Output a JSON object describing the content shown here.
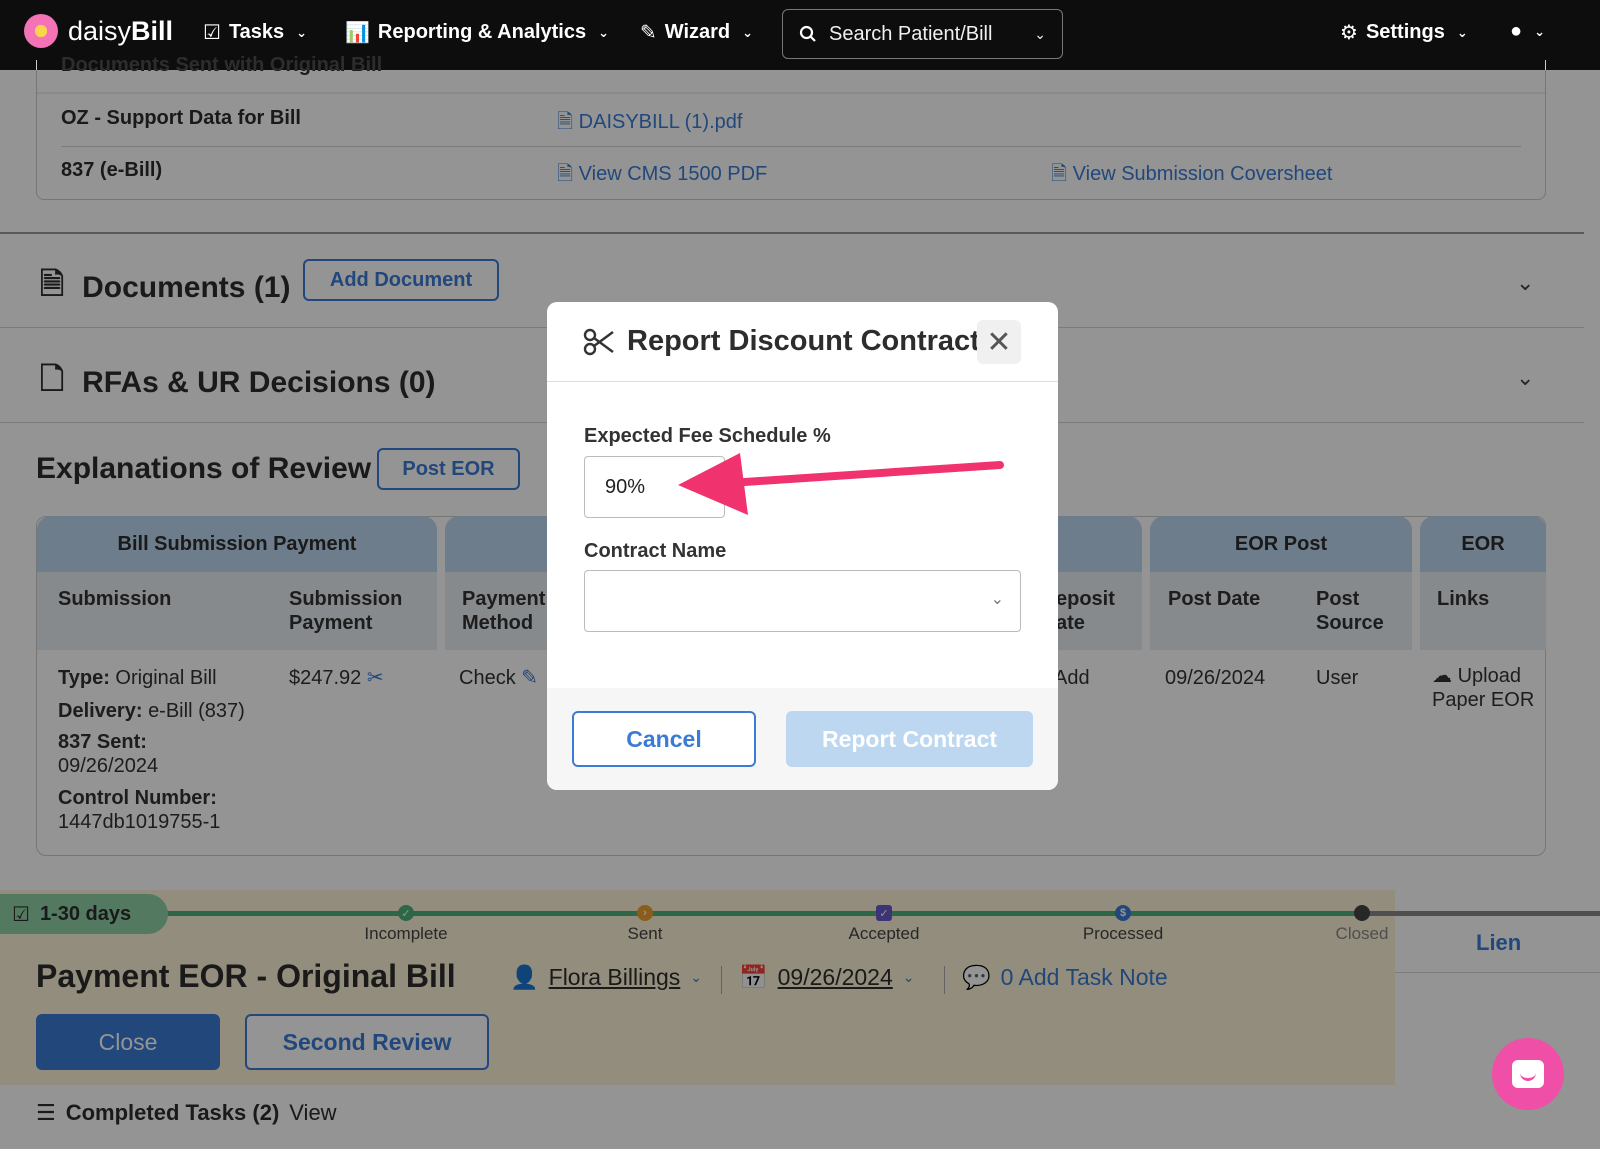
{
  "nav": {
    "brand_light": "daisy",
    "brand_bold": "Bill",
    "tasks": "Tasks",
    "reporting": "Reporting & Analytics",
    "wizard": "Wizard",
    "search_placeholder": "Search Patient/Bill",
    "settings": "Settings"
  },
  "docs_sent": {
    "header": "Documents Sent with Original Bill",
    "rows": [
      {
        "label": "OZ - Support Data for Bill",
        "link1": "DAISYBILL (1).pdf",
        "link2": ""
      },
      {
        "label": "837 (e-Bill)",
        "link1": "View CMS 1500 PDF",
        "link2": "View Submission Coversheet"
      }
    ]
  },
  "documents": {
    "title": "Documents (1)",
    "button": "Add Document"
  },
  "rfas": {
    "title": "RFAs & UR Decisions (0)"
  },
  "eor": {
    "title": "Explanations of Review",
    "button": "Post EOR",
    "groups": [
      "Bill Submission Payment",
      "EOR Post",
      "EOR"
    ],
    "columns": [
      "Submission",
      "Submission Payment",
      "Payment Method",
      "eposit ate",
      "Post Date",
      "Post Source",
      "Links"
    ],
    "row": {
      "type_label": "Type:",
      "type_value": "Original Bill",
      "delivery_label": "Delivery:",
      "delivery_value": "e-Bill (837)",
      "sent_label": "837 Sent:",
      "sent_value": "09/26/2024",
      "control_label": "Control Number:",
      "control_value": "1447db1019755-1",
      "payment": "$247.92",
      "method": "Check",
      "deposit": "Add",
      "post_date": "09/26/2024",
      "post_source": "User",
      "links": "Upload Paper EOR"
    }
  },
  "task": {
    "days": "1-30 days",
    "stages": [
      "Incomplete",
      "Sent",
      "Accepted",
      "Processed",
      "Closed"
    ],
    "title": "Payment EOR - Original Bill",
    "assignee": "Flora Billings",
    "date": "09/26/2024",
    "note": "0 Add Task Note",
    "close_btn": "Close",
    "second_review_btn": "Second Review",
    "lien": "Lien",
    "completed": "Completed Tasks (2)",
    "view": "View"
  },
  "modal": {
    "title": "Report Discount Contract",
    "fee_label": "Expected Fee Schedule %",
    "fee_value": "90%",
    "contract_label": "Contract Name",
    "contract_value": "",
    "cancel": "Cancel",
    "submit": "Report Contract"
  },
  "colors": {
    "accent": "#3a7bd5",
    "annotation_arrow": "#f0336f",
    "chat": "#ef4fa6"
  }
}
